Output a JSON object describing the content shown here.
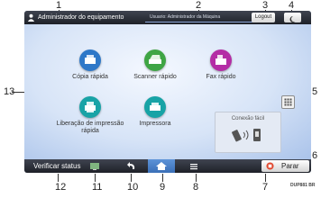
{
  "callouts": [
    "1",
    "2",
    "3",
    "4",
    "5",
    "6",
    "7",
    "8",
    "9",
    "10",
    "11",
    "12",
    "13"
  ],
  "header": {
    "admin_label": "Administrador do equipamento",
    "login_status": "Usuario: Administrador da Máquina",
    "logout_label": "Logout"
  },
  "apps": [
    {
      "label": "Cópia rápida",
      "color": "#2e78c8",
      "icon": "copier-icon"
    },
    {
      "label": "Scanner rápido",
      "color": "#3fa544",
      "icon": "scanner-icon"
    },
    {
      "label": "Fax rápido",
      "color": "#b42da5",
      "icon": "fax-icon"
    },
    {
      "label": "Liberação de impressão rápida",
      "color": "#19a3a6",
      "icon": "print-release-icon"
    },
    {
      "label": "Impressora",
      "color": "#17a3a6",
      "icon": "printer-icon"
    }
  ],
  "widget": {
    "title": "Conexão fácil",
    "icon": "nfc-phone-icon"
  },
  "footer": {
    "check_status_label": "Verificar status",
    "stop_label": "Parar"
  },
  "credit": "DUP881 BR"
}
